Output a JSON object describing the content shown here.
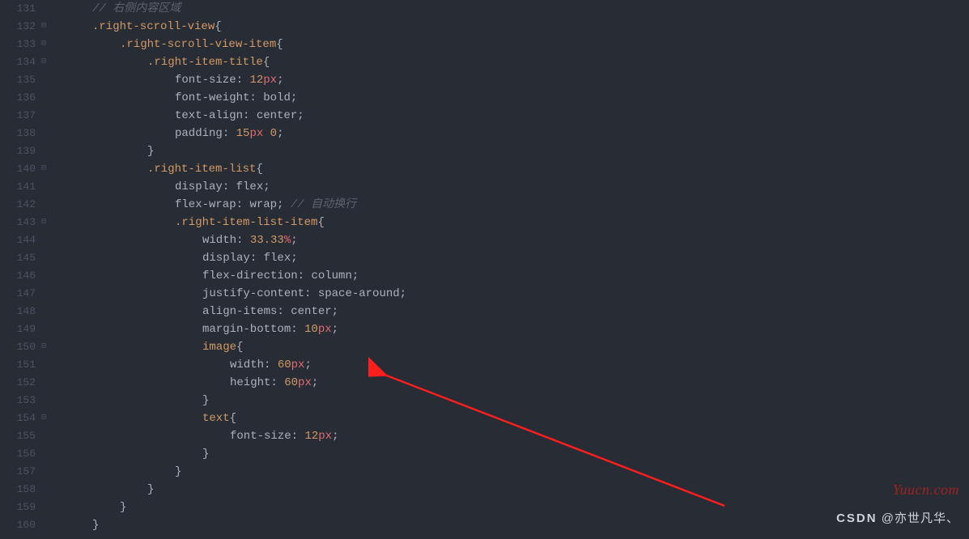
{
  "gutter": {
    "start": 131,
    "end": 160,
    "foldable": [
      132,
      133,
      134,
      140,
      143,
      150,
      154
    ]
  },
  "code": {
    "l131": {
      "indent": 1,
      "comment": "// 右侧内容区域"
    },
    "l132": {
      "indent": 1,
      "sel": ".right-scroll-view",
      "brace": "{"
    },
    "l133": {
      "indent": 2,
      "sel": ".right-scroll-view-item",
      "brace": "{"
    },
    "l134": {
      "indent": 3,
      "sel": ".right-item-title",
      "brace": "{"
    },
    "l135": {
      "indent": 4,
      "prop": "font-size",
      "num": "12",
      "unit": "px",
      "semi": ";"
    },
    "l136": {
      "indent": 4,
      "prop": "font-weight",
      "val": "bold",
      "semi": ";"
    },
    "l137": {
      "indent": 4,
      "prop": "text-align",
      "val": "center",
      "semi": ";"
    },
    "l138": {
      "indent": 4,
      "prop": "padding",
      "num": "15",
      "unit": "px",
      "extra": " 0",
      "semi": ";"
    },
    "l139": {
      "indent": 3,
      "close": "}"
    },
    "l140": {
      "indent": 3,
      "sel": ".right-item-list",
      "brace": "{"
    },
    "l141": {
      "indent": 4,
      "prop": "display",
      "val": "flex",
      "semi": ";"
    },
    "l142": {
      "indent": 4,
      "prop": "flex-wrap",
      "val": "wrap",
      "semi": ";",
      "trail_comment": " // 自动换行"
    },
    "l143": {
      "indent": 4,
      "sel": ".right-item-list-item",
      "brace": "{"
    },
    "l144": {
      "indent": 5,
      "prop": "width",
      "num": "33.33",
      "unit": "%",
      "semi": ";"
    },
    "l145": {
      "indent": 5,
      "prop": "display",
      "val": "flex",
      "semi": ";"
    },
    "l146": {
      "indent": 5,
      "prop": "flex-direction",
      "val": "column",
      "semi": ";"
    },
    "l147": {
      "indent": 5,
      "prop": "justify-content",
      "val": "space-around",
      "semi": ";"
    },
    "l148": {
      "indent": 5,
      "prop": "align-items",
      "val": "center",
      "semi": ";"
    },
    "l149": {
      "indent": 5,
      "prop": "margin-bottom",
      "num": "10",
      "unit": "px",
      "semi": ";"
    },
    "l150": {
      "indent": 5,
      "sel": "image",
      "brace": "{"
    },
    "l151": {
      "indent": 6,
      "prop": "width",
      "num": "60",
      "unit": "px",
      "semi": ";"
    },
    "l152": {
      "indent": 6,
      "prop": "height",
      "num": "60",
      "unit": "px",
      "semi": ";"
    },
    "l153": {
      "indent": 5,
      "close": "}"
    },
    "l154": {
      "indent": 5,
      "sel": "text",
      "brace": "{"
    },
    "l155": {
      "indent": 6,
      "prop": "font-size",
      "num": "12",
      "unit": "px",
      "semi": ";"
    },
    "l156": {
      "indent": 5,
      "close": "}"
    },
    "l157": {
      "indent": 4,
      "close": "}"
    },
    "l158": {
      "indent": 3,
      "close": "}"
    },
    "l159": {
      "indent": 2,
      "close": "}"
    },
    "l160": {
      "indent": 1,
      "close": "}"
    }
  },
  "watermark": {
    "yuucn": "Yuucn.com",
    "csdn_prefix": "CSDN",
    "csdn_author": " @亦世凡华、"
  }
}
